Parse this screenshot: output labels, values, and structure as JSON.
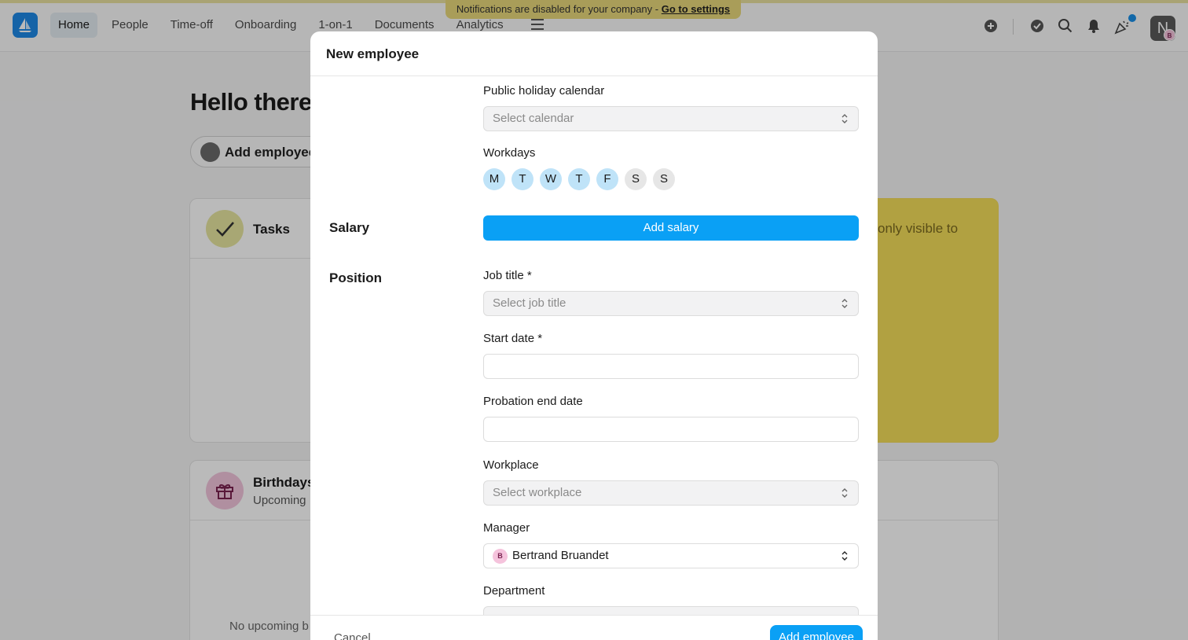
{
  "topbar": {
    "notification_text": "Notifications are disabled for your company -",
    "notification_link": "Go to settings",
    "nav": [
      "Home",
      "People",
      "Time-off",
      "Onboarding",
      "1-on-1",
      "Documents",
      "Analytics"
    ],
    "active_nav": "Home",
    "user_initial": "N",
    "user_mini_initial": "B"
  },
  "page": {
    "greeting": "Hello there,",
    "add_employee_label": "Add employee",
    "tasks_title": "Tasks",
    "yellow_text": "only visible to",
    "birthdays_title": "Birthdays",
    "birthdays_subtitle": "Upcoming",
    "no_upcoming": "No upcoming b"
  },
  "modal": {
    "title": "New employee",
    "public_holiday_label": "Public holiday calendar",
    "public_holiday_placeholder": "Select calendar",
    "workdays_label": "Workdays",
    "workdays": [
      {
        "day": "M",
        "on": true
      },
      {
        "day": "T",
        "on": true
      },
      {
        "day": "W",
        "on": true
      },
      {
        "day": "T",
        "on": true
      },
      {
        "day": "F",
        "on": true
      },
      {
        "day": "S",
        "on": false
      },
      {
        "day": "S",
        "on": false
      }
    ],
    "salary_section": "Salary",
    "add_salary": "Add salary",
    "position_section": "Position",
    "job_title_label": "Job title *",
    "job_title_placeholder": "Select job title",
    "start_date_label": "Start date *",
    "probation_label": "Probation end date",
    "workplace_label": "Workplace",
    "workplace_placeholder": "Select workplace",
    "manager_label": "Manager",
    "manager_value": "Bertrand Bruandet",
    "manager_initial": "B",
    "department_label": "Department",
    "cancel": "Cancel",
    "submit": "Add employee"
  },
  "colors": {
    "accent_blue": "#0aa0f5",
    "banner_yellow": "#e8d87a",
    "workday_on": "#bfe3f8",
    "workday_off": "#e6e6e6",
    "yellow_card": "#f3dd5a"
  }
}
